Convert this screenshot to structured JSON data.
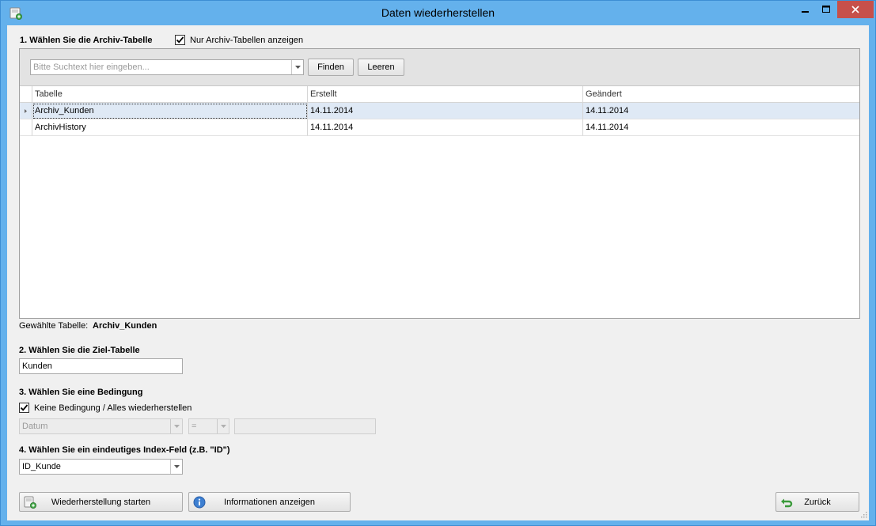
{
  "window": {
    "title": "Daten wiederherstellen"
  },
  "section1": {
    "label": "1. Wählen Sie die Archiv-Tabelle",
    "only_archive_label": "Nur Archiv-Tabellen anzeigen",
    "only_archive_checked": true,
    "search": {
      "placeholder": "Bitte Suchtext hier eingeben..."
    },
    "find_label": "Finden",
    "clear_label": "Leeren",
    "columns": [
      "Tabelle",
      "Erstellt",
      "Geändert"
    ],
    "rows": [
      {
        "table": "Archiv_Kunden",
        "created": "14.11.2014",
        "modified": "14.11.2014",
        "selected": true
      },
      {
        "table": "ArchivHistory",
        "created": "14.11.2014",
        "modified": "14.11.2014",
        "selected": false
      }
    ],
    "selected_label": "Gewählte Tabelle:",
    "selected_value": "Archiv_Kunden"
  },
  "section2": {
    "label": "2. Wählen Sie die Ziel-Tabelle",
    "target_value": "Kunden"
  },
  "section3": {
    "label": "3. Wählen Sie eine Bedingung",
    "no_condition_label": "Keine Bedingung / Alles wiederherstellen",
    "no_condition_checked": true,
    "field_value": "Datum",
    "operator_value": "=",
    "condition_value": ""
  },
  "section4": {
    "label": "4. Wählen Sie ein eindeutiges Index-Feld (z.B. \"ID\")",
    "index_value": "ID_Kunde"
  },
  "footer": {
    "start_label": "Wiederherstellung starten",
    "info_label": "Informationen anzeigen",
    "back_label": "Zurück"
  }
}
